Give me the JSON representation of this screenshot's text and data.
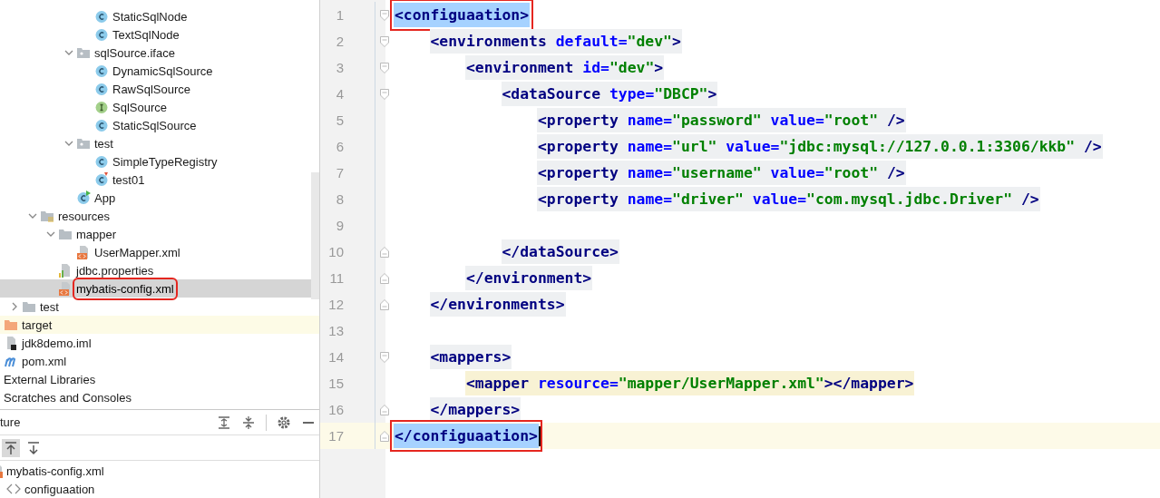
{
  "project_tree": {
    "children": [
      {
        "children": [
          {
            "children": [
              {
                "children": [
                  {
                    "children": [
                      {
                        "children": [
                          {
                            "children": [
                              {
                                "label": "StaticSqlNode",
                                "kind": "class",
                                "selected": false,
                                "annotated": false
                              },
                              {
                                "label": "TextSqlNode",
                                "kind": "class",
                                "selected": false,
                                "annotated": false
                              }
                            ]
                          },
                          {
                            "label": "sqlSource.iface",
                            "kind": "package",
                            "expanded": true,
                            "selected": false,
                            "annotated": false,
                            "children": [
                              {
                                "label": "DynamicSqlSource",
                                "kind": "class",
                                "selected": false,
                                "annotated": false
                              },
                              {
                                "label": "RawSqlSource",
                                "kind": "class",
                                "selected": false,
                                "annotated": false
                              },
                              {
                                "label": "SqlSource",
                                "kind": "interface",
                                "selected": false,
                                "annotated": false
                              },
                              {
                                "label": "StaticSqlSource",
                                "kind": "class",
                                "selected": false,
                                "annotated": false
                              }
                            ]
                          },
                          {
                            "label": "test",
                            "kind": "package",
                            "expanded": true,
                            "selected": false,
                            "annotated": false,
                            "children": [
                              {
                                "label": "SimpleTypeRegistry",
                                "kind": "class",
                                "selected": false,
                                "annotated": false
                              },
                              {
                                "label": "test01",
                                "kind": "test-class",
                                "selected": false,
                                "annotated": false
                              }
                            ]
                          },
                          {
                            "label": "App",
                            "kind": "main-class",
                            "selected": false,
                            "annotated": false
                          }
                        ]
                      }
                    ]
                  },
                  {
                    "label": "resources",
                    "kind": "resources-folder",
                    "expanded": true,
                    "selected": false,
                    "annotated": false,
                    "children": [
                      {
                        "label": "mapper",
                        "kind": "folder",
                        "expanded": true,
                        "selected": false,
                        "annotated": false,
                        "children": [
                          {
                            "label": "UserMapper.xml",
                            "kind": "xml",
                            "selected": false,
                            "annotated": false
                          }
                        ]
                      },
                      {
                        "label": "jdbc.properties",
                        "kind": "properties",
                        "selected": false,
                        "annotated": false
                      },
                      {
                        "label": "mybatis-config.xml",
                        "kind": "xml",
                        "selected": true,
                        "annotated": true
                      }
                    ]
                  }
                ]
              },
              {
                "label": "test",
                "kind": "folder",
                "expanded": false,
                "selected": false,
                "annotated": false
              }
            ]
          },
          {
            "label": "target",
            "kind": "excluded-folder",
            "selected": false,
            "annotated": false
          },
          {
            "label": "jdk8demo.iml",
            "kind": "iml",
            "selected": false,
            "annotated": false
          },
          {
            "label": "pom.xml",
            "kind": "maven",
            "selected": false,
            "annotated": false
          }
        ]
      },
      {
        "label": "External Libraries",
        "selected": false,
        "annotated": false
      },
      {
        "label": "Scratches and Consoles",
        "selected": false,
        "annotated": false
      }
    ]
  },
  "structure": {
    "title": "ture",
    "toolbar": [
      {
        "kind": "scroll-to-source",
        "selected": true
      },
      {
        "kind": "scroll-from-source",
        "selected": false
      }
    ],
    "tree": [
      {
        "label": "mybatis-config.xml",
        "kind": "xml",
        "children": [
          {
            "label": "configuaation",
            "kind": "tag"
          }
        ]
      }
    ]
  },
  "editor": {
    "line_numbers": [
      "1",
      "2",
      "3",
      "4",
      "5",
      "6",
      "7",
      "8",
      "9",
      "10",
      "11",
      "12",
      "13",
      "14",
      "15",
      "16",
      "17"
    ],
    "code": [
      {
        "kind": "element",
        "selected": true,
        "annotated": true,
        "current": true,
        "open": [
          {
            "kind": "tag",
            "text": "<configuaation>"
          }
        ],
        "close": [
          {
            "kind": "tag",
            "text": "</configuaation>"
          }
        ],
        "children": [
          {
            "kind": "element",
            "selected": false,
            "annotated": false,
            "highlighted": false,
            "open": [
              {
                "kind": "tag",
                "text": "<environments"
              },
              {
                "kind": "attr",
                "text": " default="
              },
              {
                "kind": "value",
                "text": "\"dev\""
              },
              {
                "kind": "tag",
                "text": ">"
              }
            ],
            "close": [
              {
                "kind": "tag",
                "text": "</environments>"
              }
            ],
            "children": [
              {
                "kind": "element",
                "selected": false,
                "annotated": false,
                "highlighted": false,
                "open": [
                  {
                    "kind": "tag",
                    "text": "<environment"
                  },
                  {
                    "kind": "attr",
                    "text": " id="
                  },
                  {
                    "kind": "value",
                    "text": "\"dev\""
                  },
                  {
                    "kind": "tag",
                    "text": ">"
                  }
                ],
                "close": [
                  {
                    "kind": "tag",
                    "text": "</environment>"
                  }
                ],
                "children": [
                  {
                    "kind": "element",
                    "selected": false,
                    "annotated": false,
                    "highlighted": false,
                    "open": [
                      {
                        "kind": "tag",
                        "text": "<dataSource"
                      },
                      {
                        "kind": "attr",
                        "text": " type="
                      },
                      {
                        "kind": "value",
                        "text": "\"DBCP\""
                      },
                      {
                        "kind": "tag",
                        "text": ">"
                      }
                    ],
                    "close": [
                      {
                        "kind": "tag",
                        "text": "</dataSource>"
                      }
                    ],
                    "children": [
                      {
                        "kind": "leaf",
                        "selected": false,
                        "annotated": false,
                        "highlighted": false,
                        "tokens": [
                          {
                            "kind": "tag",
                            "text": "<property"
                          },
                          {
                            "kind": "attr",
                            "text": " name="
                          },
                          {
                            "kind": "value",
                            "text": "\"password\""
                          },
                          {
                            "kind": "attr",
                            "text": " value="
                          },
                          {
                            "kind": "value",
                            "text": "\"root\""
                          },
                          {
                            "kind": "tag",
                            "text": " />"
                          }
                        ]
                      },
                      {
                        "kind": "leaf",
                        "selected": false,
                        "annotated": false,
                        "highlighted": false,
                        "tokens": [
                          {
                            "kind": "tag",
                            "text": "<property"
                          },
                          {
                            "kind": "attr",
                            "text": " name="
                          },
                          {
                            "kind": "value",
                            "text": "\"url\""
                          },
                          {
                            "kind": "attr",
                            "text": " value="
                          },
                          {
                            "kind": "value",
                            "text": "\"jdbc:mysql://127.0.0.1:3306/kkb\""
                          },
                          {
                            "kind": "tag",
                            "text": " />"
                          }
                        ]
                      },
                      {
                        "kind": "leaf",
                        "selected": false,
                        "annotated": false,
                        "highlighted": false,
                        "tokens": [
                          {
                            "kind": "tag",
                            "text": "<property"
                          },
                          {
                            "kind": "attr",
                            "text": " name="
                          },
                          {
                            "kind": "value",
                            "text": "\"username\""
                          },
                          {
                            "kind": "attr",
                            "text": " value="
                          },
                          {
                            "kind": "value",
                            "text": "\"root\""
                          },
                          {
                            "kind": "tag",
                            "text": " />"
                          }
                        ]
                      },
                      {
                        "kind": "leaf",
                        "selected": false,
                        "annotated": false,
                        "highlighted": false,
                        "tokens": [
                          {
                            "kind": "tag",
                            "text": "<property"
                          },
                          {
                            "kind": "attr",
                            "text": " name="
                          },
                          {
                            "kind": "value",
                            "text": "\"driver\""
                          },
                          {
                            "kind": "attr",
                            "text": " value="
                          },
                          {
                            "kind": "value",
                            "text": "\"com.mysql.jdbc.Driver\""
                          },
                          {
                            "kind": "tag",
                            "text": " />"
                          }
                        ]
                      },
                      {
                        "kind": "blank"
                      }
                    ]
                  }
                ]
              }
            ]
          },
          {
            "kind": "blank"
          },
          {
            "kind": "element",
            "selected": false,
            "annotated": false,
            "highlighted": false,
            "open": [
              {
                "kind": "tag",
                "text": "<mappers>"
              }
            ],
            "close": [
              {
                "kind": "tag",
                "text": "</mappers>"
              }
            ],
            "children": [
              {
                "kind": "leaf",
                "selected": false,
                "annotated": false,
                "highlighted": true,
                "tokens": [
                  {
                    "kind": "tag",
                    "text": "<mapper"
                  },
                  {
                    "kind": "attr",
                    "text": " resource="
                  },
                  {
                    "kind": "value",
                    "text": "\"mapper/UserMapper.xml\""
                  },
                  {
                    "kind": "tag",
                    "text": "></mapper>"
                  }
                ]
              }
            ]
          }
        ]
      }
    ]
  }
}
